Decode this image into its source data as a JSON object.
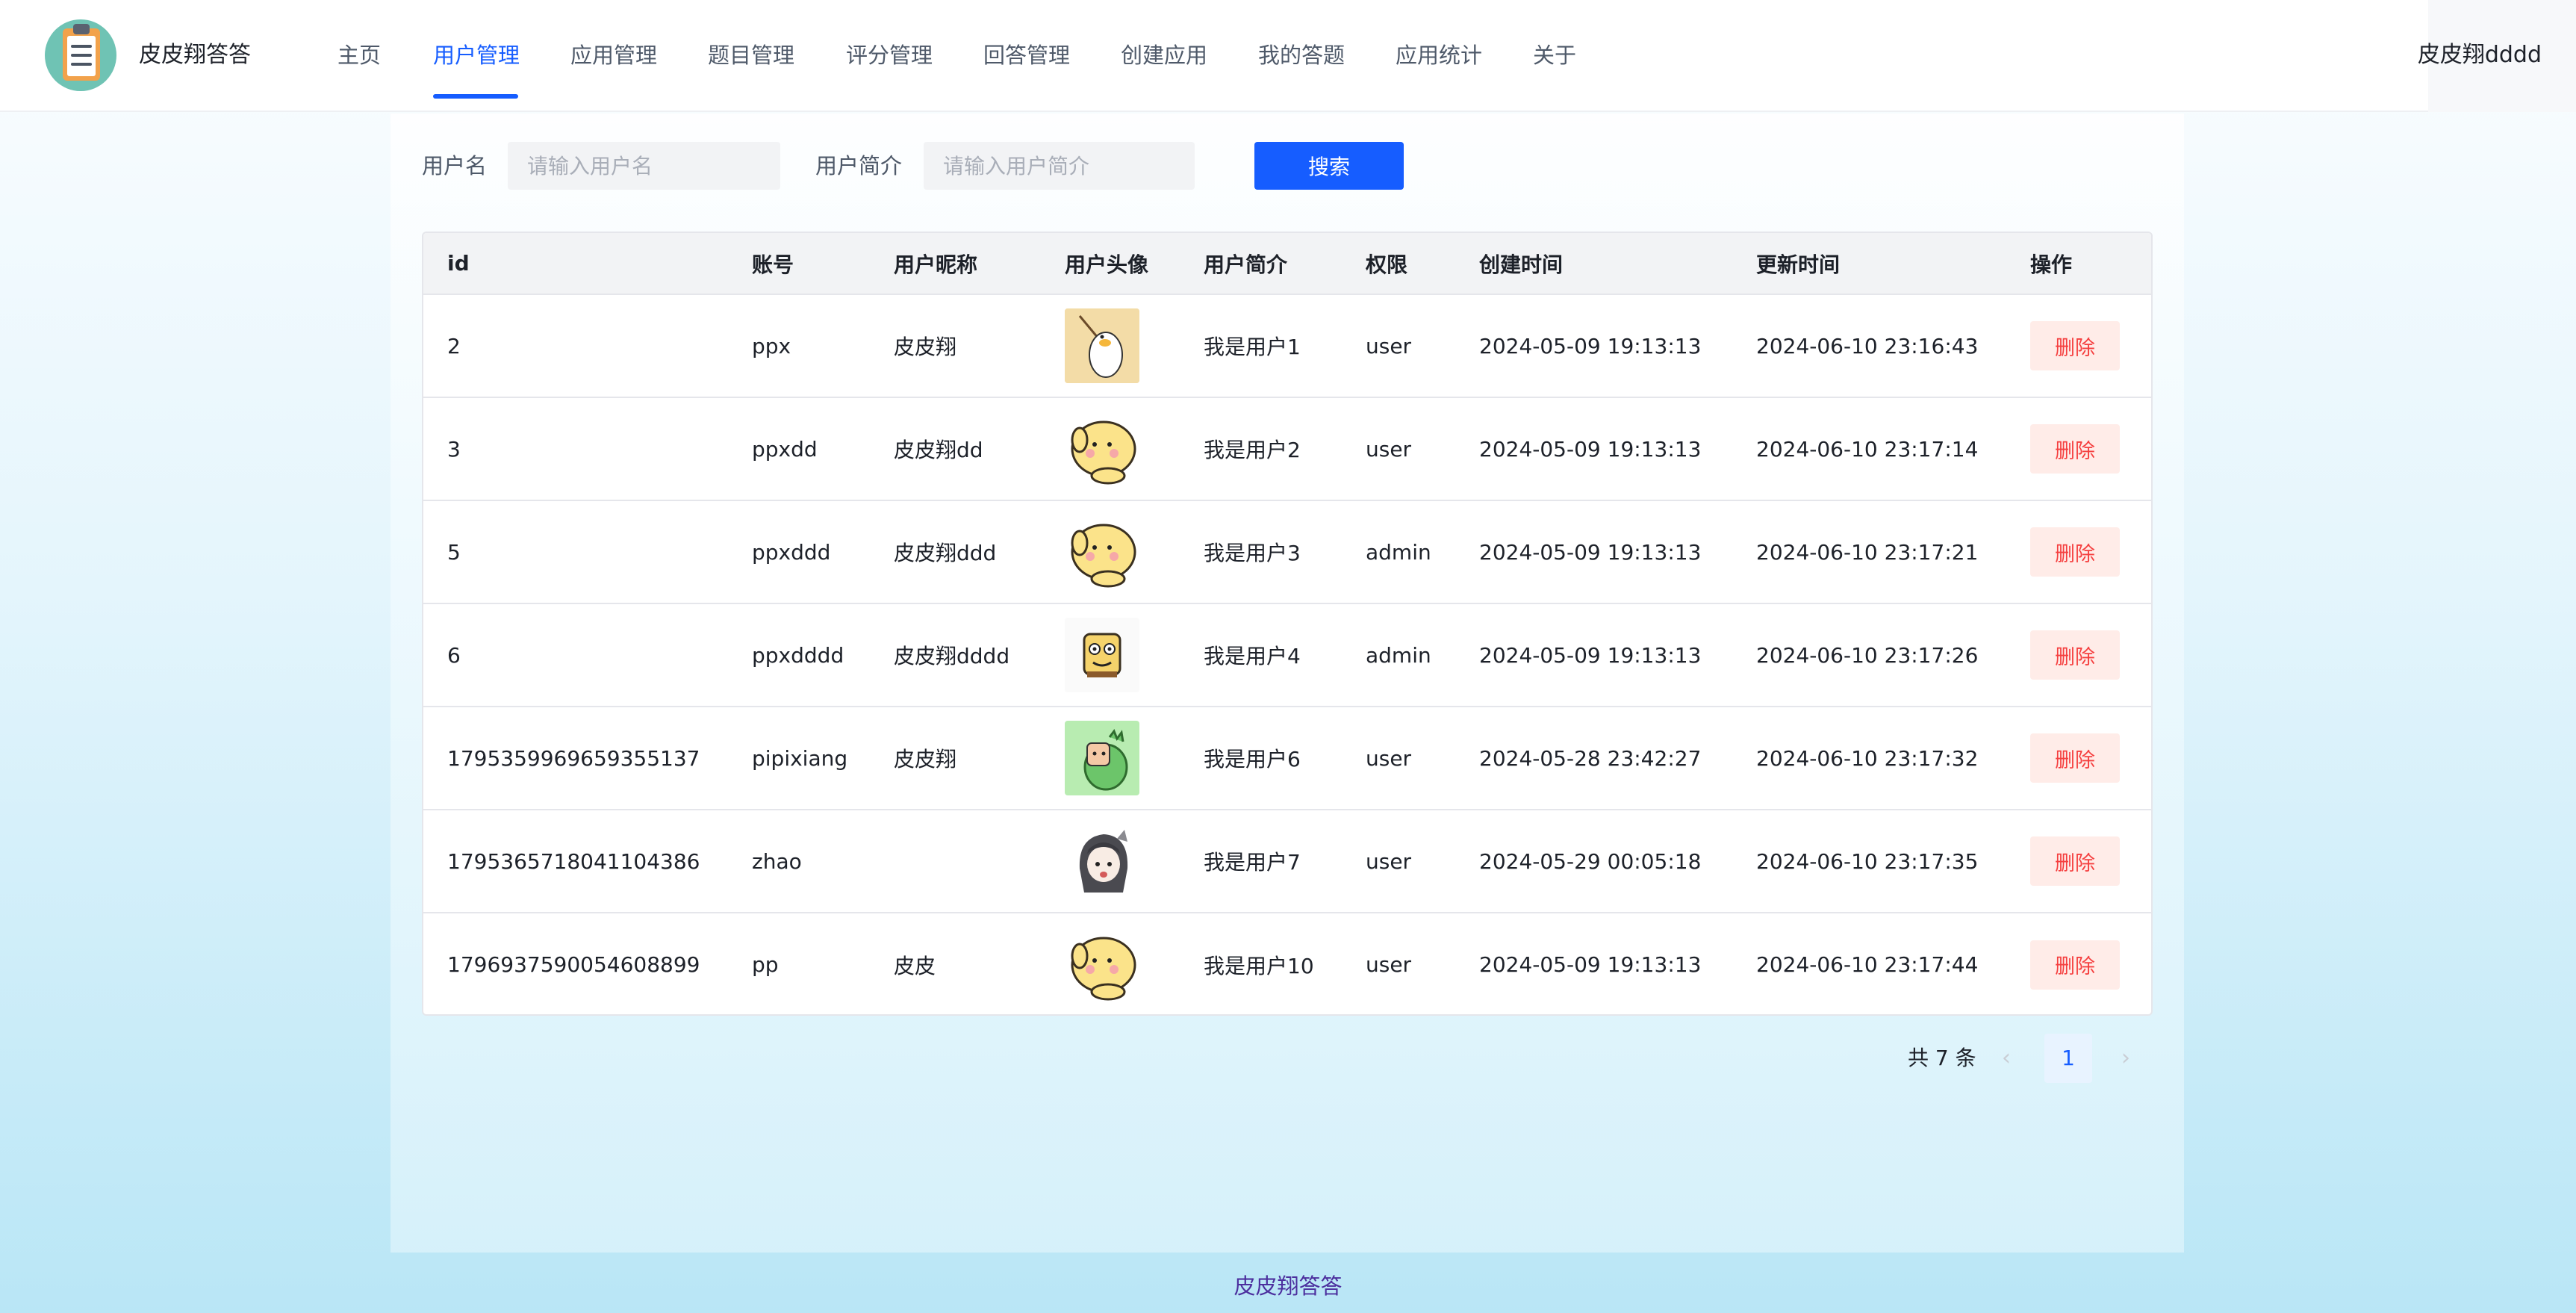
{
  "app": {
    "brand": "皮皮翔答答",
    "user": "皮皮翔dddd"
  },
  "nav": {
    "items": [
      {
        "label": "主页"
      },
      {
        "label": "用户管理",
        "active": true
      },
      {
        "label": "应用管理"
      },
      {
        "label": "题目管理"
      },
      {
        "label": "评分管理"
      },
      {
        "label": "回答管理"
      },
      {
        "label": "创建应用"
      },
      {
        "label": "我的答题"
      },
      {
        "label": "应用统计"
      },
      {
        "label": "关于"
      }
    ]
  },
  "search": {
    "username_label": "用户名",
    "username_placeholder": "请输入用户名",
    "profile_label": "用户简介",
    "profile_placeholder": "请输入用户简介",
    "button_label": "搜索"
  },
  "table": {
    "columns": [
      "id",
      "账号",
      "用户昵称",
      "用户头像",
      "用户简介",
      "权限",
      "创建时间",
      "更新时间",
      "操作"
    ],
    "rows": [
      {
        "id": "2",
        "account": "ppx",
        "nickname": "皮皮翔",
        "avatar": "duck-avatar",
        "profile": "我是用户1",
        "role": "user",
        "created": "2024-05-09 19:13:13",
        "updated": "2024-06-10 23:16:43",
        "action": "删除"
      },
      {
        "id": "3",
        "account": "ppxdd",
        "nickname": "皮皮翔dd",
        "avatar": "yellow-dog-avatar",
        "profile": "我是用户2",
        "role": "user",
        "created": "2024-05-09 19:13:13",
        "updated": "2024-06-10 23:17:14",
        "action": "删除"
      },
      {
        "id": "5",
        "account": "ppxddd",
        "nickname": "皮皮翔ddd",
        "avatar": "yellow-dog-avatar",
        "profile": "我是用户3",
        "role": "admin",
        "created": "2024-05-09 19:13:13",
        "updated": "2024-06-10 23:17:21",
        "action": "删除"
      },
      {
        "id": "6",
        "account": "ppxdddd",
        "nickname": "皮皮翔dddd",
        "avatar": "sponge-avatar",
        "profile": "我是用户4",
        "role": "admin",
        "created": "2024-05-09 19:13:13",
        "updated": "2024-06-10 23:17:26",
        "action": "删除"
      },
      {
        "id": "1795359969659355137",
        "account": "pipixiang",
        "nickname": "皮皮翔",
        "avatar": "green-dino-avatar",
        "profile": "我是用户6",
        "role": "user",
        "created": "2024-05-28 23:42:27",
        "updated": "2024-06-10 23:17:32",
        "action": "删除"
      },
      {
        "id": "1795365718041104386",
        "account": "zhao",
        "nickname": "",
        "avatar": "anime-girl-avatar",
        "profile": "我是用户7",
        "role": "user",
        "created": "2024-05-29 00:05:18",
        "updated": "2024-06-10 23:17:35",
        "action": "删除"
      },
      {
        "id": "1796937590054608899",
        "account": "pp",
        "nickname": "皮皮",
        "avatar": "yellow-dog-avatar",
        "profile": "我是用户10",
        "role": "user",
        "created": "2024-05-09 19:13:13",
        "updated": "2024-06-10 23:17:44",
        "action": "删除"
      }
    ]
  },
  "pagination": {
    "total_text": "共 7 条",
    "current_page": "1",
    "prev_icon": "‹",
    "next_icon": "›"
  },
  "footer": {
    "text": "皮皮翔答答"
  },
  "colors": {
    "accent": "#165dff",
    "danger": "#f53f3f",
    "danger_bg": "#ffece8",
    "footer_text": "#4c2f9e"
  }
}
